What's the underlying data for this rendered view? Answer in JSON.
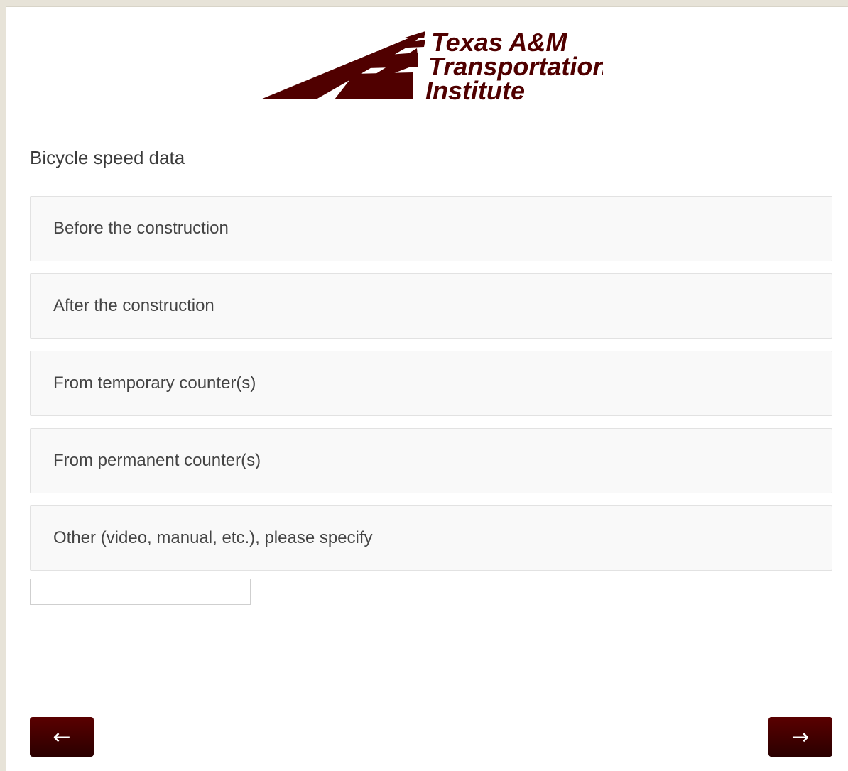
{
  "logo": {
    "line1": "Texas A&M",
    "line2": "Transportation",
    "line3": "Institute",
    "color": "#500000"
  },
  "question": {
    "text": "Bicycle speed data"
  },
  "choices": [
    {
      "label": "Before the construction"
    },
    {
      "label": "After the construction"
    },
    {
      "label": "From temporary counter(s)"
    },
    {
      "label": "From permanent counter(s)"
    },
    {
      "label": "Other (video, manual, etc.), please specify"
    }
  ],
  "other_input": {
    "value": "",
    "placeholder": ""
  },
  "navigation": {
    "back_label": "←",
    "next_label": "→"
  },
  "colors": {
    "accent": "#500000",
    "choice_bg": "#f9f9f9",
    "choice_border": "#e2e2e2",
    "text": "#444444"
  }
}
